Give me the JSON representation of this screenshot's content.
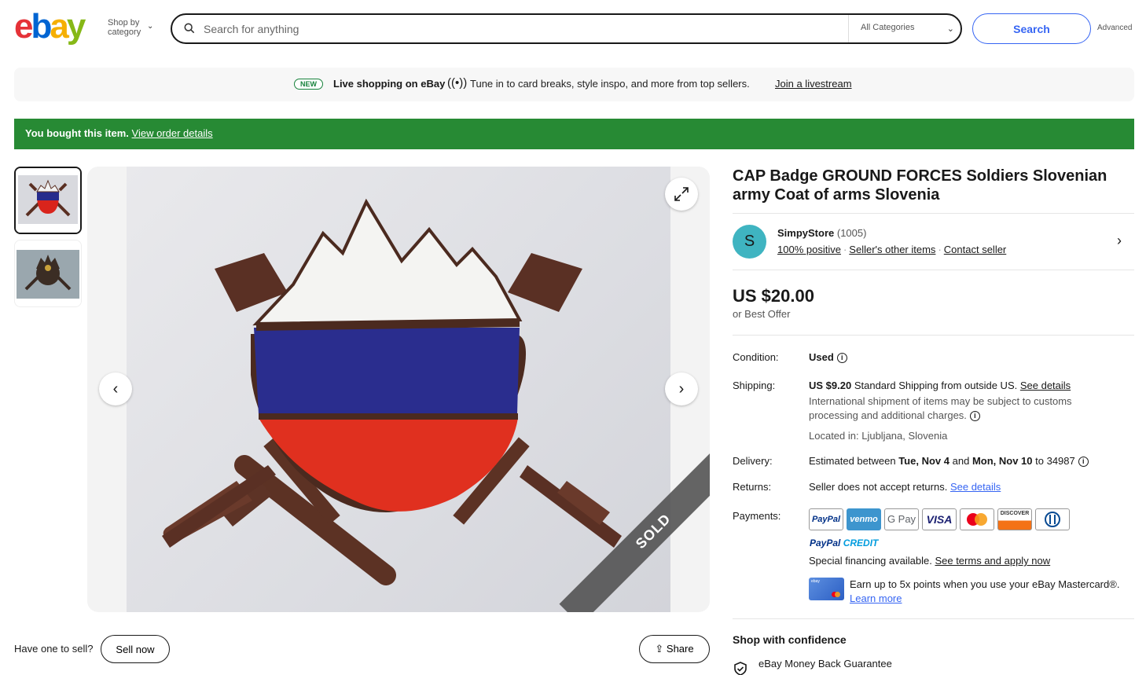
{
  "header": {
    "logo_letters": [
      "e",
      "b",
      "a",
      "y"
    ],
    "shop_by_line1": "Shop by",
    "shop_by_line2": "category",
    "search_placeholder": "Search for anything",
    "category_select": "All Categories",
    "search_button": "Search",
    "advanced_link": "Advanced"
  },
  "promo": {
    "badge": "NEW",
    "title": "Live shopping on eBay",
    "text": "Tune in to card breaks, style inspo, and more from top sellers.",
    "link": "Join a livestream"
  },
  "bought_banner": {
    "text": "You bought this item.",
    "link": "View order details",
    "color": "#278a34"
  },
  "gallery": {
    "sold_label": "SOLD",
    "thumbnail_count": 2
  },
  "sell_bar": {
    "question": "Have one to sell?",
    "sell_button": "Sell now",
    "share_button": "Share"
  },
  "listing": {
    "title": "CAP Badge GROUND FORCES Soldiers Slovenian army Coat of arms Slovenia",
    "seller": {
      "initial": "S",
      "name": "SimpyStore",
      "feedback_count": "(1005)",
      "positive": "100% positive",
      "other_items": "Seller's other items",
      "contact": "Contact seller"
    },
    "price": "US $20.00",
    "best_offer": "or Best Offer",
    "condition_label": "Condition:",
    "condition_value": "Used",
    "shipping_label": "Shipping:",
    "shipping_price": "US $9.20",
    "shipping_text": "Standard Shipping from outside US.",
    "shipping_link": "See details",
    "shipping_note": "International shipment of items may be subject to customs processing and additional charges.",
    "location": "Located in: Ljubljana, Slovenia",
    "delivery_label": "Delivery:",
    "delivery_prefix": "Estimated between",
    "delivery_start": "Tue, Nov 4",
    "delivery_and": "and",
    "delivery_end": "Mon, Nov 10",
    "delivery_zip": "to 34987",
    "returns_label": "Returns:",
    "returns_text": "Seller does not accept returns.",
    "returns_link": "See details",
    "payments_label": "Payments:",
    "payment_methods": [
      "PayPal",
      "venmo",
      "G Pay",
      "VISA",
      "Mastercard",
      "DISCOVER",
      "Diners Club"
    ],
    "paypal_credit_1": "PayPal",
    "paypal_credit_2": "CREDIT",
    "financing_text": "Special financing available.",
    "financing_link": "See terms and apply now",
    "mastercard_text": "Earn up to 5x points when you use your eBay Mastercard®.",
    "mastercard_link": "Learn more",
    "confidence_title": "Shop with confidence",
    "money_back": "eBay Money Back Guarantee"
  }
}
